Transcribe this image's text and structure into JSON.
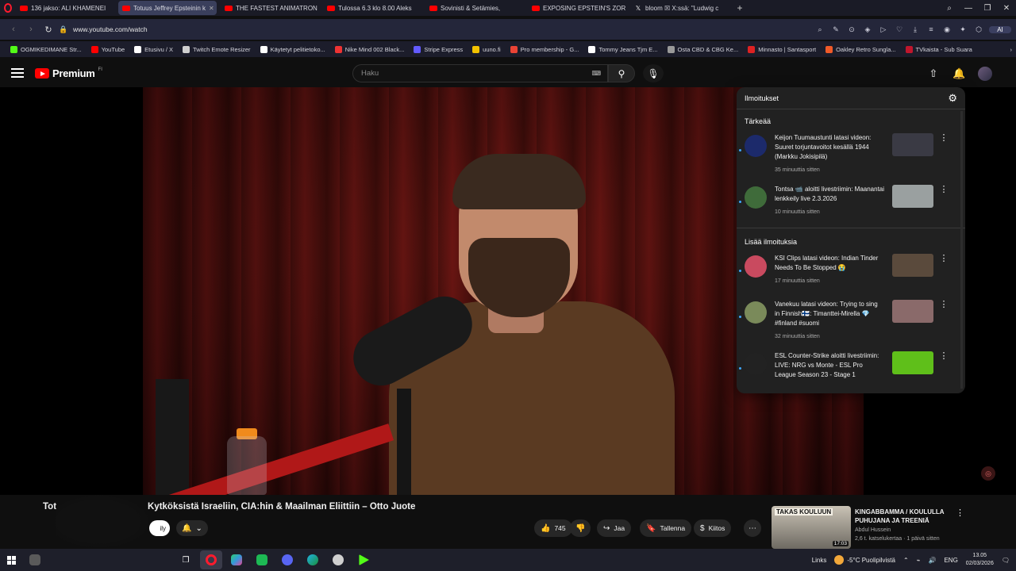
{
  "browser": {
    "tabs": [
      {
        "label": "136 jakso: ALI KHAMENEI",
        "active": false
      },
      {
        "label": "Totuus Jeffrey Epsteinin k",
        "active": true
      },
      {
        "label": "THE FASTEST ANIMATRON",
        "active": false
      },
      {
        "label": "Tulossa 6.3 klo 8.00 Aleks",
        "active": false
      },
      {
        "label": "Sovinisti & Setämies,",
        "active": false
      },
      {
        "label": "EXPOSING EPSTEIN'S ZOR",
        "active": false
      },
      {
        "label": "bloom ☒ X:ssä: \"Ludwig c",
        "active": false
      }
    ],
    "url": "www.youtube.com/watch",
    "ai_label": "AI",
    "bookmarks": [
      {
        "label": "OGMIKEDIMANE Str...",
        "color": "#53fc18"
      },
      {
        "label": "YouTube",
        "color": "#ff0000"
      },
      {
        "label": "Etusivu / X",
        "color": "#ffffff"
      },
      {
        "label": "Twitch Emote Resizer",
        "color": "#cfcfcf"
      },
      {
        "label": "Käytetyt pelitietoko...",
        "color": "#ffffff"
      },
      {
        "label": "Nike Mind 002 Black...",
        "color": "#e33"
      },
      {
        "label": "Stripe Express",
        "color": "#635bff"
      },
      {
        "label": "uuno.fi",
        "color": "#f2c200"
      },
      {
        "label": "Pro membership - G...",
        "color": "#ea4335"
      },
      {
        "label": "Tommy Jeans Tjm E...",
        "color": "#ffffff"
      },
      {
        "label": "Osta CBD & CBG Ke...",
        "color": "#999999"
      },
      {
        "label": "Minnasto | Santasport",
        "color": "#d22"
      },
      {
        "label": "Oakley Retro Sunglа...",
        "color": "#f05a28"
      },
      {
        "label": "TVkaista - Sub Suara",
        "color": "#c0162c"
      }
    ]
  },
  "youtube": {
    "logo_text": "Premium",
    "logo_sup": "FI",
    "search_placeholder": "Haku",
    "notifications": {
      "title": "Ilmoitukset",
      "section_important": "Tärkeää",
      "section_more": "Lisää ilmoituksia",
      "important": [
        {
          "text": "Keijon Tuumaustunti latasi videon: Suuret torjuntavoitot kesällä 1944 (Markku Jokisipilä)",
          "time": "35 minuuttia sitten",
          "avatar_color": "#1c2a6b",
          "thumb_color": "#3a3a44"
        },
        {
          "text": "Tontsa 📹 aloitti livestriimin: Maanantai lenkkeily live 2.3.2026",
          "time": "10 minuuttia sitten",
          "avatar_color": "#3f6b3a",
          "thumb_color": "#9aa0a0"
        }
      ],
      "more": [
        {
          "text": "KSI Clips latasi videon: Indian Tinder Needs To Be Stopped 😭",
          "time": "17 minuuttia sitten",
          "avatar_color": "#c94a5f",
          "thumb_color": "#5a4a3c"
        },
        {
          "text": "Vanekuu latasi videon: Trying to sing in Finnish🇫🇮: Timanttei-Mirella 💎 #finland #suomi",
          "time": "32 minuuttia sitten",
          "avatar_color": "#7a8a5a",
          "thumb_color": "#8a6a6a"
        },
        {
          "text": "ESL Counter-Strike aloitti livestriimin: LIVE: NRG vs Monte - ESL Pro League Season 23 - Stage 1",
          "time": "",
          "avatar_color": "#222222",
          "thumb_color": "#5fbf1a"
        }
      ]
    },
    "video": {
      "title_prefix": "Tot",
      "title": "Kytköksistä Israeliin, CIA:hin & Maailman Eliittiin – Otto Juote",
      "subscribe_label": "ily",
      "likes": "745",
      "share_label": "Jaa",
      "save_label": "Tallenna",
      "thanks_label": "Kiitos"
    },
    "recommendation": {
      "thumb_text": "TAKAS KOULUUN",
      "duration": "17:03",
      "title": "KINGABBAMMA / KOULULLA PUHUJANA JA TREENIÄ",
      "channel": "Abdul Hussein",
      "meta": "2,6 t. katselukertaa · 1 päivä sitten"
    }
  },
  "taskbar": {
    "links_label": "Links",
    "weather": "-5°C  Puolipilvistä",
    "lang": "ENG",
    "time": "13.05",
    "date": "02/03/2026"
  }
}
